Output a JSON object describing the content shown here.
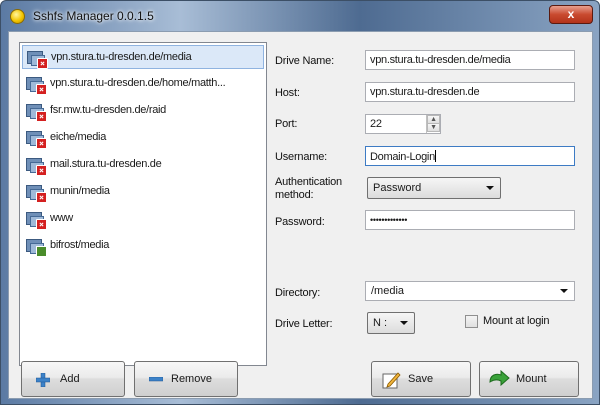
{
  "window": {
    "title": "Sshfs Manager 0.0.1.5",
    "close_glyph": "x"
  },
  "mounts": [
    {
      "label": "vpn.stura.tu-dresden.de/media",
      "status": "disconnected",
      "selected": true
    },
    {
      "label": "vpn.stura.tu-dresden.de/home/matth...",
      "status": "disconnected"
    },
    {
      "label": "fsr.mw.tu-dresden.de/raid",
      "status": "disconnected"
    },
    {
      "label": "eiche/media",
      "status": "disconnected"
    },
    {
      "label": "mail.stura.tu-dresden.de",
      "status": "disconnected"
    },
    {
      "label": "munin/media",
      "status": "disconnected"
    },
    {
      "label": "www",
      "status": "disconnected"
    },
    {
      "label": "bifrost/media",
      "status": "network"
    }
  ],
  "form": {
    "drive_name_label": "Drive Name:",
    "drive_name_value": "vpn.stura.tu-dresden.de/media",
    "host_label": "Host:",
    "host_value": "vpn.stura.tu-dresden.de",
    "port_label": "Port:",
    "port_value": "22",
    "username_label": "Username:",
    "username_value": "Domain-Login",
    "auth_label_line1": "Authentication",
    "auth_label_line2": "method:",
    "auth_value": "Password",
    "password_label": "Password:",
    "password_value": "•••••••••••••",
    "directory_label": "Directory:",
    "directory_value": "/media",
    "drive_letter_label": "Drive Letter:",
    "drive_letter_value": "N :",
    "mount_at_login_label": "Mount at login",
    "mount_at_login_checked": false
  },
  "buttons": {
    "add": "Add",
    "remove": "Remove",
    "save": "Save",
    "mount": "Mount"
  },
  "colors": {
    "selection": "#dbe8f8",
    "accent_blue": "#3d7bc4",
    "status_disconnected": "#d42020",
    "status_network": "#4a8c2a"
  }
}
